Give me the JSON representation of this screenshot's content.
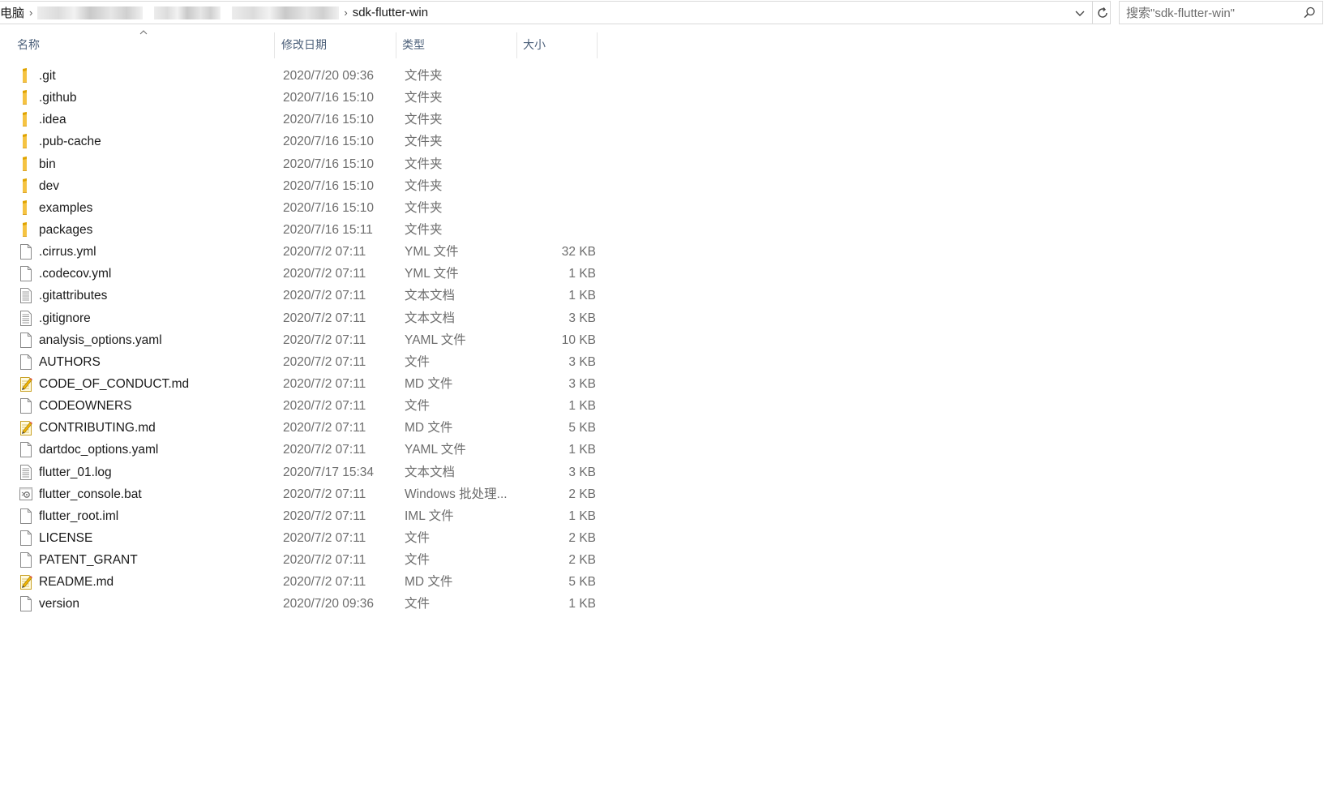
{
  "address": {
    "root": "电脑",
    "current": "sdk-flutter-win"
  },
  "search": {
    "placeholder": "搜索\"sdk-flutter-win\""
  },
  "columns": {
    "name": "名称",
    "date": "修改日期",
    "type": "类型",
    "size": "大小"
  },
  "files": [
    {
      "name": ".git",
      "date": "2020/7/20 09:36",
      "type": "文件夹",
      "size": "",
      "icon": "folder-icon"
    },
    {
      "name": ".github",
      "date": "2020/7/16 15:10",
      "type": "文件夹",
      "size": "",
      "icon": "folder-icon"
    },
    {
      "name": ".idea",
      "date": "2020/7/16 15:10",
      "type": "文件夹",
      "size": "",
      "icon": "folder-icon"
    },
    {
      "name": ".pub-cache",
      "date": "2020/7/16 15:10",
      "type": "文件夹",
      "size": "",
      "icon": "folder-icon"
    },
    {
      "name": "bin",
      "date": "2020/7/16 15:10",
      "type": "文件夹",
      "size": "",
      "icon": "folder-icon"
    },
    {
      "name": "dev",
      "date": "2020/7/16 15:10",
      "type": "文件夹",
      "size": "",
      "icon": "folder-icon"
    },
    {
      "name": "examples",
      "date": "2020/7/16 15:10",
      "type": "文件夹",
      "size": "",
      "icon": "folder-icon"
    },
    {
      "name": "packages",
      "date": "2020/7/16 15:11",
      "type": "文件夹",
      "size": "",
      "icon": "folder-icon"
    },
    {
      "name": ".cirrus.yml",
      "date": "2020/7/2 07:11",
      "type": "YML 文件",
      "size": "32 KB",
      "icon": "file-icon"
    },
    {
      "name": ".codecov.yml",
      "date": "2020/7/2 07:11",
      "type": "YML 文件",
      "size": "1 KB",
      "icon": "file-icon"
    },
    {
      "name": ".gitattributes",
      "date": "2020/7/2 07:11",
      "type": "文本文档",
      "size": "1 KB",
      "icon": "text-file-icon"
    },
    {
      "name": ".gitignore",
      "date": "2020/7/2 07:11",
      "type": "文本文档",
      "size": "3 KB",
      "icon": "text-file-icon"
    },
    {
      "name": "analysis_options.yaml",
      "date": "2020/7/2 07:11",
      "type": "YAML 文件",
      "size": "10 KB",
      "icon": "file-icon"
    },
    {
      "name": "AUTHORS",
      "date": "2020/7/2 07:11",
      "type": "文件",
      "size": "3 KB",
      "icon": "file-icon"
    },
    {
      "name": "CODE_OF_CONDUCT.md",
      "date": "2020/7/2 07:11",
      "type": "MD 文件",
      "size": "3 KB",
      "icon": "markdown-file-icon"
    },
    {
      "name": "CODEOWNERS",
      "date": "2020/7/2 07:11",
      "type": "文件",
      "size": "1 KB",
      "icon": "file-icon"
    },
    {
      "name": "CONTRIBUTING.md",
      "date": "2020/7/2 07:11",
      "type": "MD 文件",
      "size": "5 KB",
      "icon": "markdown-file-icon"
    },
    {
      "name": "dartdoc_options.yaml",
      "date": "2020/7/2 07:11",
      "type": "YAML 文件",
      "size": "1 KB",
      "icon": "file-icon"
    },
    {
      "name": "flutter_01.log",
      "date": "2020/7/17 15:34",
      "type": "文本文档",
      "size": "3 KB",
      "icon": "text-file-icon"
    },
    {
      "name": "flutter_console.bat",
      "date": "2020/7/2 07:11",
      "type": "Windows 批处理...",
      "size": "2 KB",
      "icon": "batch-file-icon"
    },
    {
      "name": "flutter_root.iml",
      "date": "2020/7/2 07:11",
      "type": "IML 文件",
      "size": "1 KB",
      "icon": "file-icon"
    },
    {
      "name": "LICENSE",
      "date": "2020/7/2 07:11",
      "type": "文件",
      "size": "2 KB",
      "icon": "file-icon"
    },
    {
      "name": "PATENT_GRANT",
      "date": "2020/7/2 07:11",
      "type": "文件",
      "size": "2 KB",
      "icon": "file-icon"
    },
    {
      "name": "README.md",
      "date": "2020/7/2 07:11",
      "type": "MD 文件",
      "size": "5 KB",
      "icon": "markdown-file-icon"
    },
    {
      "name": "version",
      "date": "2020/7/20 09:36",
      "type": "文件",
      "size": "1 KB",
      "icon": "file-icon"
    }
  ]
}
